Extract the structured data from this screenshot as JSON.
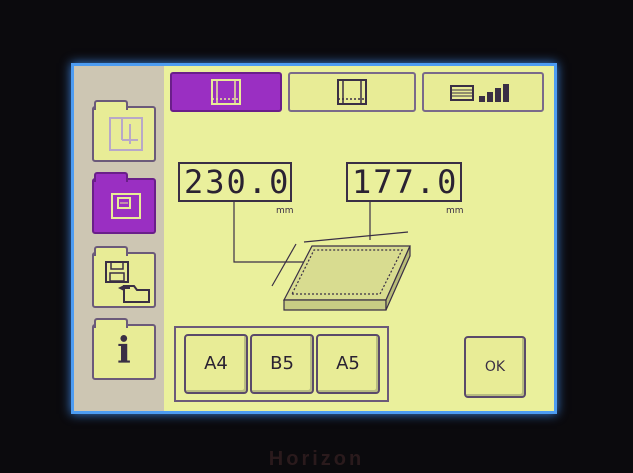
{
  "device": {
    "brand": "Horizon"
  },
  "sidebar": {
    "items": [
      {
        "icon": "folder-layout-icon",
        "active": false
      },
      {
        "icon": "folder-printer-icon",
        "active": true
      },
      {
        "icon": "floppy-folder-icon",
        "active": false
      },
      {
        "icon": "info-icon",
        "label": "i",
        "active": false
      }
    ]
  },
  "tabs": [
    {
      "icon": "sheet-frame-icon",
      "active": true
    },
    {
      "icon": "sheet-frame-outline-icon",
      "active": false
    },
    {
      "icon": "stack-volume-icon",
      "active": false
    }
  ],
  "dimensions": {
    "width": {
      "value": "230.0",
      "unit": "mm"
    },
    "height": {
      "value": "177.0",
      "unit": "mm"
    }
  },
  "presets": [
    {
      "label": "A4"
    },
    {
      "label": "B5"
    },
    {
      "label": "A5"
    }
  ],
  "ok_label": "OK",
  "colors": {
    "screen_bg": "#eaf09c",
    "active": "#9a2fc2",
    "frame": "#4d9cf2"
  }
}
